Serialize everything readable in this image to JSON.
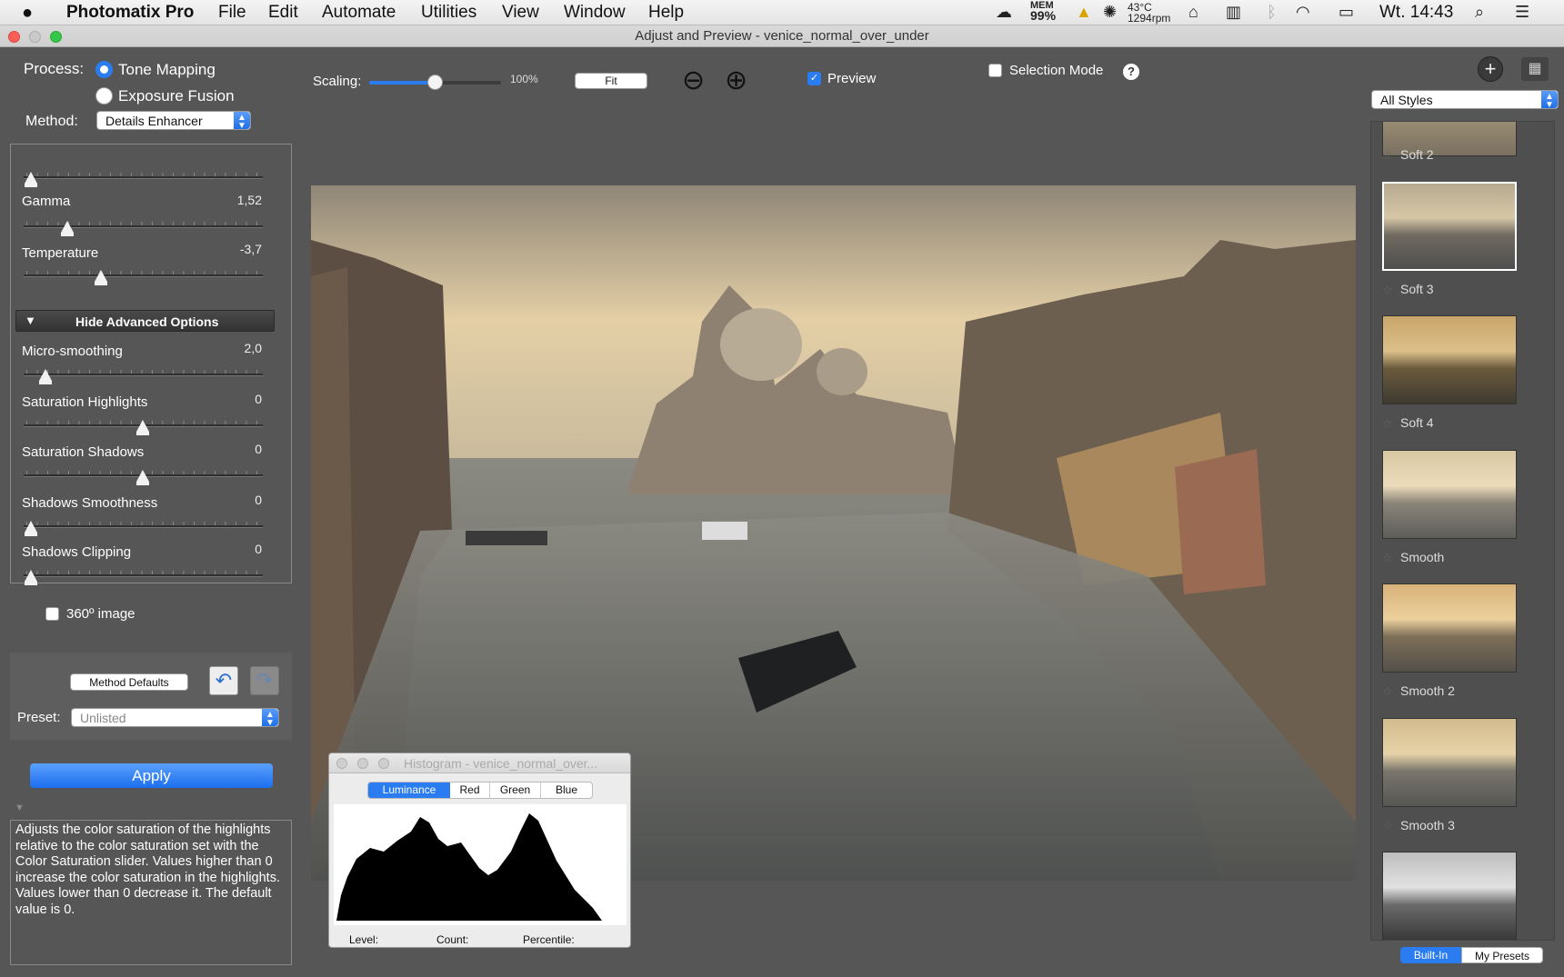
{
  "menubar": {
    "app": "Photomatix Pro",
    "items": [
      "File",
      "Edit",
      "Automate",
      "Utilities",
      "View",
      "Window",
      "Help"
    ],
    "mem_label": "MEM",
    "mem_value": "99%",
    "temp": "43°C",
    "fan": "1294rpm",
    "clock": "Wt. 14:43"
  },
  "window": {
    "title": "Adjust and Preview - venice_normal_over_under"
  },
  "left": {
    "process_label": "Process:",
    "tone_mapping": "Tone Mapping",
    "exposure_fusion": "Exposure Fusion",
    "method_label": "Method:",
    "method_value": "Details Enhancer",
    "sliders_top": [
      {
        "label": "Gamma",
        "value": "1,52"
      },
      {
        "label": "Temperature",
        "value": "-3,7"
      }
    ],
    "advanced_label": "Hide Advanced Options",
    "sliders_adv": [
      {
        "label": "Micro-smoothing",
        "value": "2,0"
      },
      {
        "label": "Saturation Highlights",
        "value": "0"
      },
      {
        "label": "Saturation Shadows",
        "value": "0"
      },
      {
        "label": "Shadows Smoothness",
        "value": "0"
      },
      {
        "label": "Shadows Clipping",
        "value": "0"
      }
    ],
    "image360": "360º image",
    "method_defaults": "Method Defaults",
    "preset_label": "Preset:",
    "preset_value": "Unlisted",
    "apply": "Apply",
    "help_text": "Adjusts the color saturation of the highlights relative to the color saturation set with the Color Saturation slider. Values higher than 0 increase the color saturation in the highlights. Values lower than 0 decrease it. The default value is 0."
  },
  "toolbar": {
    "scaling_label": "Scaling:",
    "scaling_value": "100%",
    "fit": "Fit",
    "preview": "Preview",
    "selection_mode": "Selection Mode",
    "help": "?"
  },
  "histogram": {
    "title": "Histogram - venice_normal_over...",
    "tabs": [
      "Luminance",
      "Red",
      "Green",
      "Blue"
    ],
    "level": "Level:",
    "count": "Count:",
    "percentile": "Percentile:"
  },
  "styles": {
    "filter": "All Styles",
    "items": [
      "Soft 2",
      "Soft 3",
      "Soft 4",
      "Smooth",
      "Smooth 2",
      "Smooth 3"
    ],
    "built_in": "Built-In",
    "my_presets": "My Presets"
  },
  "colors": {
    "accent": "#1f6fe9",
    "panel": "#565656"
  }
}
